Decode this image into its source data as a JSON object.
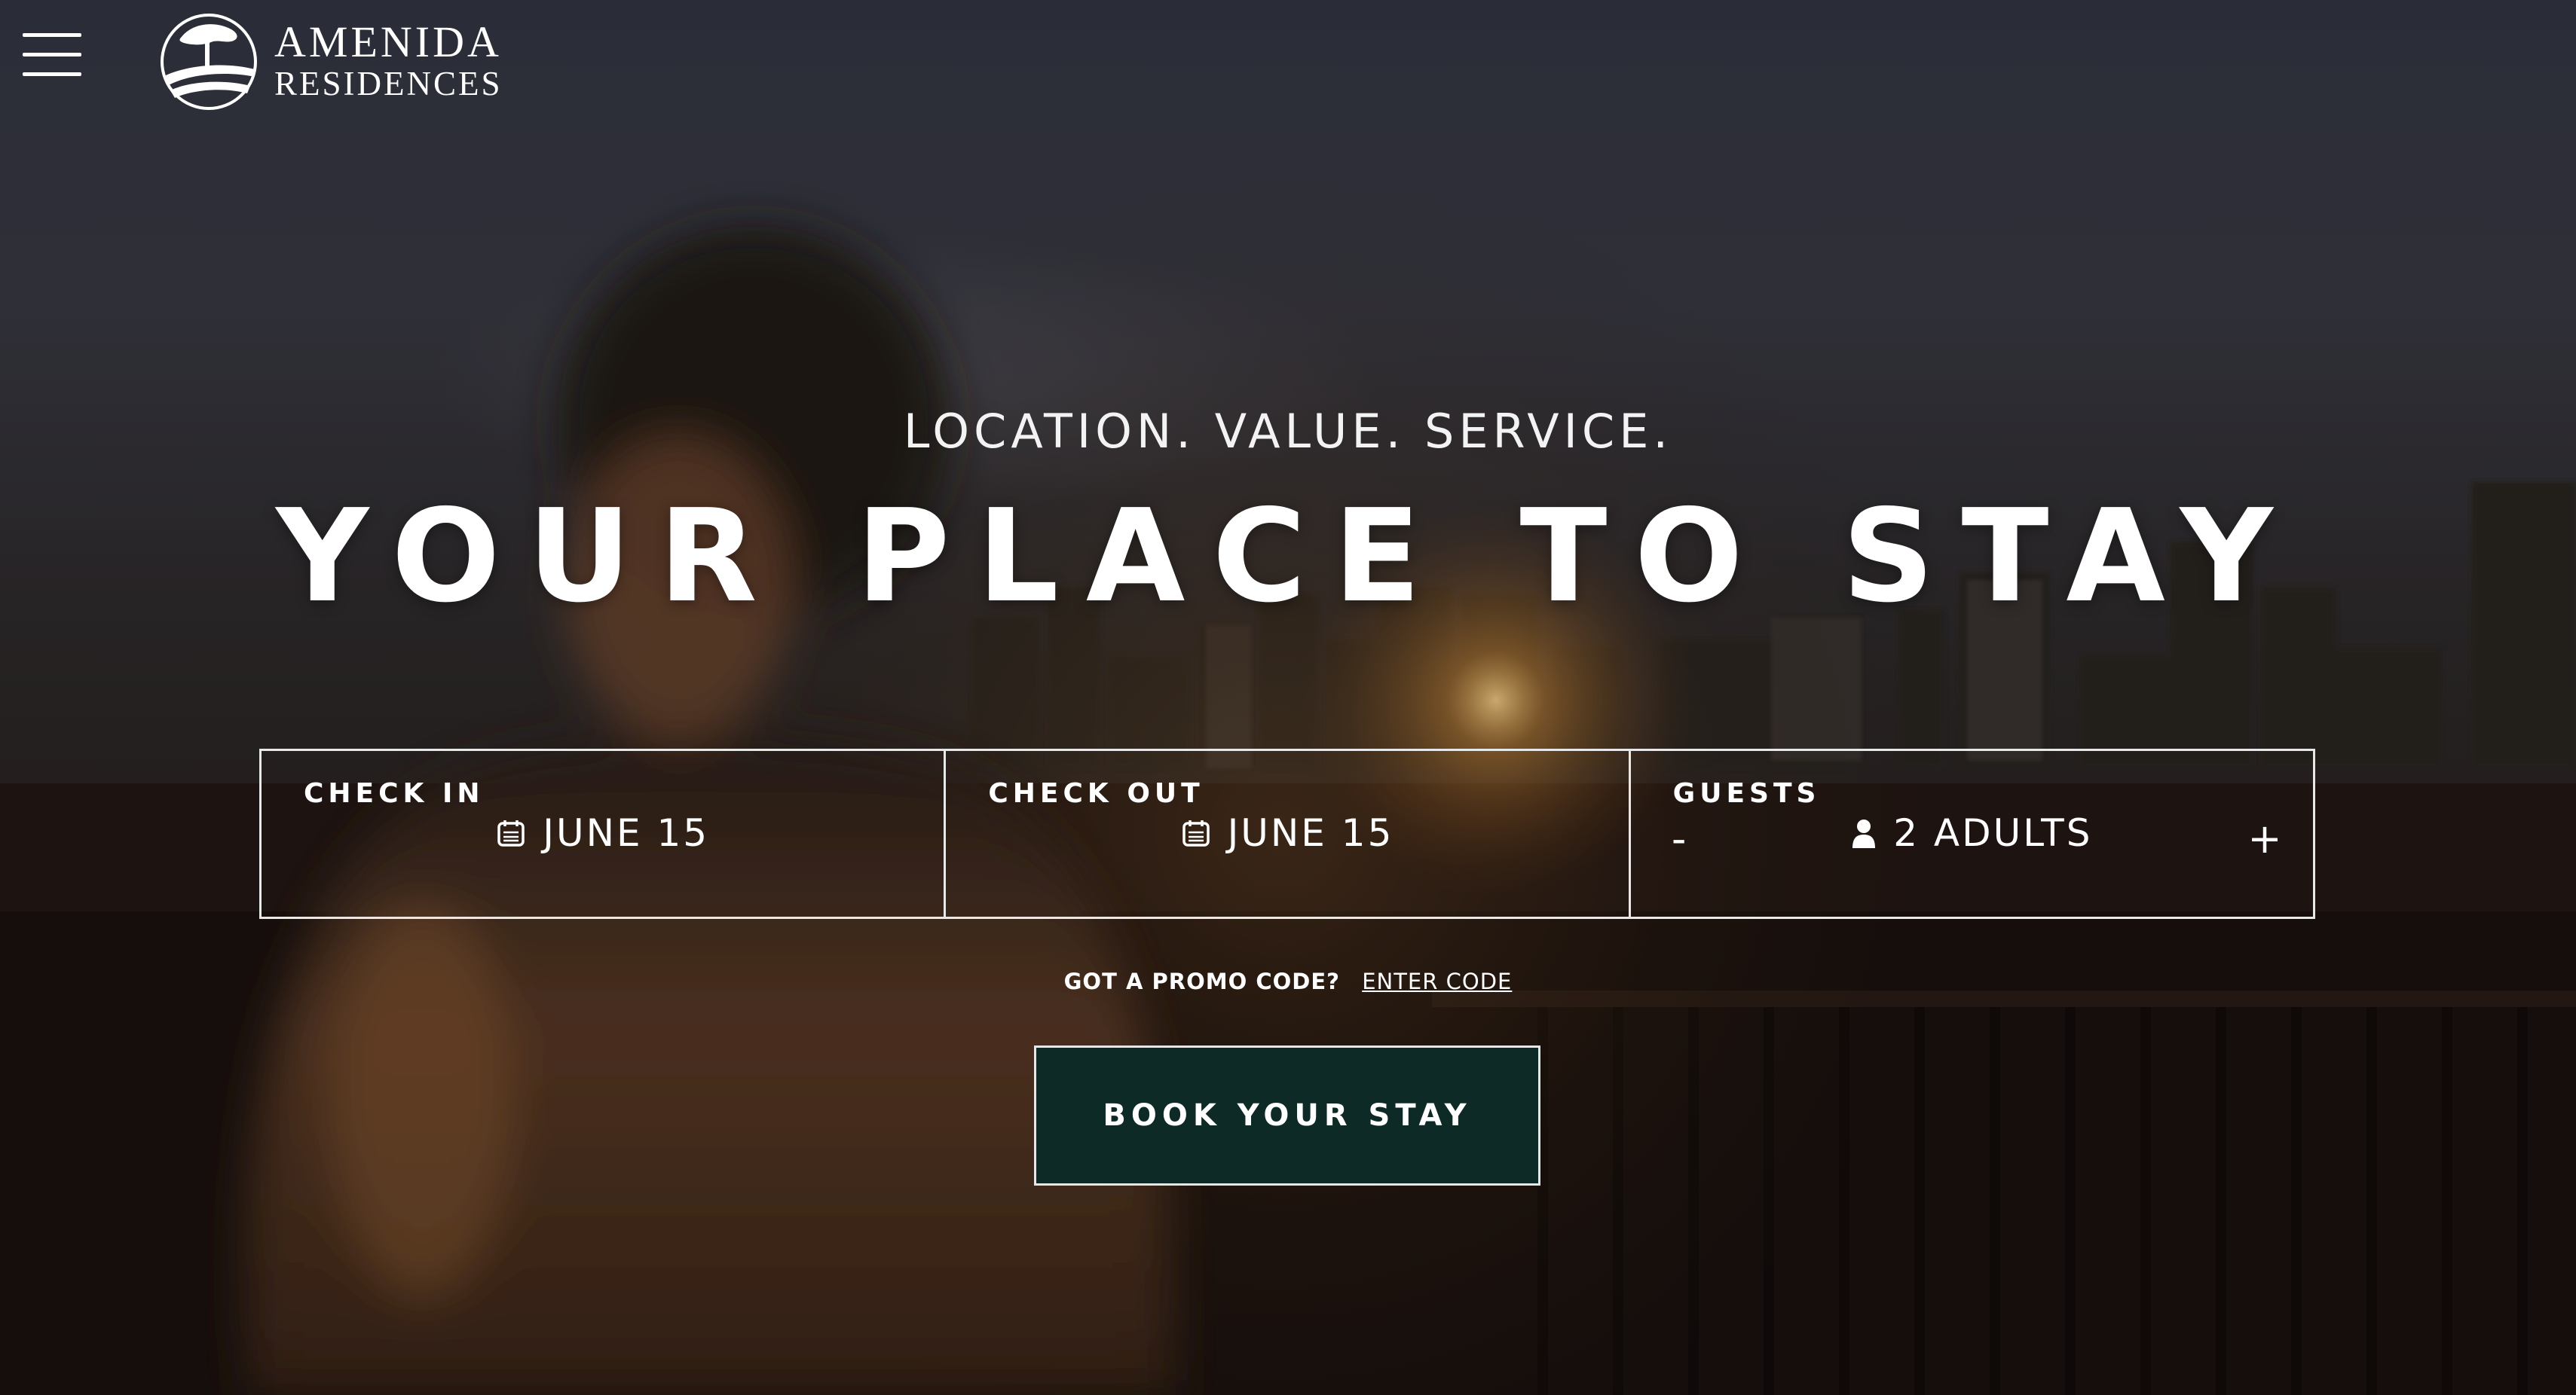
{
  "header": {
    "logo_line1": "AMENIDA",
    "logo_line2": "RESIDENCES"
  },
  "hero": {
    "tagline": "LOCATION. VALUE. SERVICE.",
    "headline": "YOUR PLACE TO STAY"
  },
  "booking": {
    "check_in": {
      "label": "CHECK IN",
      "value": "JUNE 15",
      "icon": "calendar-icon"
    },
    "check_out": {
      "label": "CHECK OUT",
      "value": "JUNE 15",
      "icon": "calendar-icon"
    },
    "guests": {
      "label": "GUESTS",
      "value": "2 ADULTS",
      "icon": "person-icon",
      "decrement": "-",
      "increment": "+"
    }
  },
  "promo": {
    "question": "GOT A PROMO CODE?",
    "link": "ENTER CODE"
  },
  "cta": {
    "label": "BOOK YOUR STAY"
  },
  "colors": {
    "cta_background": "#0e2a26",
    "text": "#ffffff",
    "border": "#e8e8e8"
  }
}
